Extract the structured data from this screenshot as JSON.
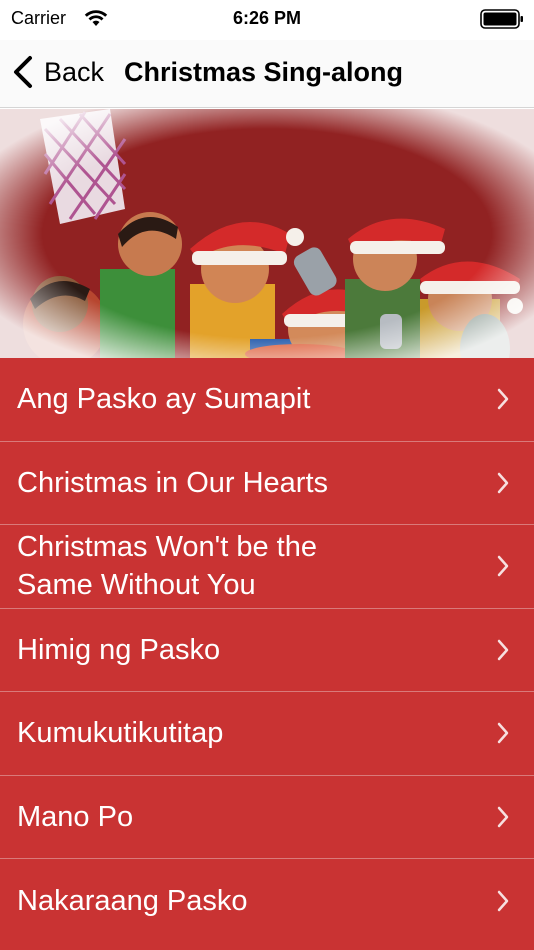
{
  "status_bar": {
    "carrier": "Carrier",
    "time": "6:26 PM",
    "wifi_icon": "wifi-icon",
    "battery_icon": "battery-icon"
  },
  "nav": {
    "back_label": "Back",
    "title": "Christmas Sing-along",
    "back_icon": "chevron-left-icon"
  },
  "hero": {
    "description_icon": "caroling-children-illustration"
  },
  "songs": [
    {
      "label": "Ang Pasko ay Sumapit"
    },
    {
      "label": "Christmas in Our Hearts"
    },
    {
      "label": "Christmas Won't be the Same Without You"
    },
    {
      "label": "Himig ng Pasko"
    },
    {
      "label": "Kumukutikutitap"
    },
    {
      "label": "Mano Po"
    },
    {
      "label": "Nakaraang Pasko"
    }
  ],
  "colors": {
    "list_background": "#c93333",
    "list_separator": "#d97a7a",
    "row_text": "#ffffff",
    "nav_background": "#fafafa"
  }
}
